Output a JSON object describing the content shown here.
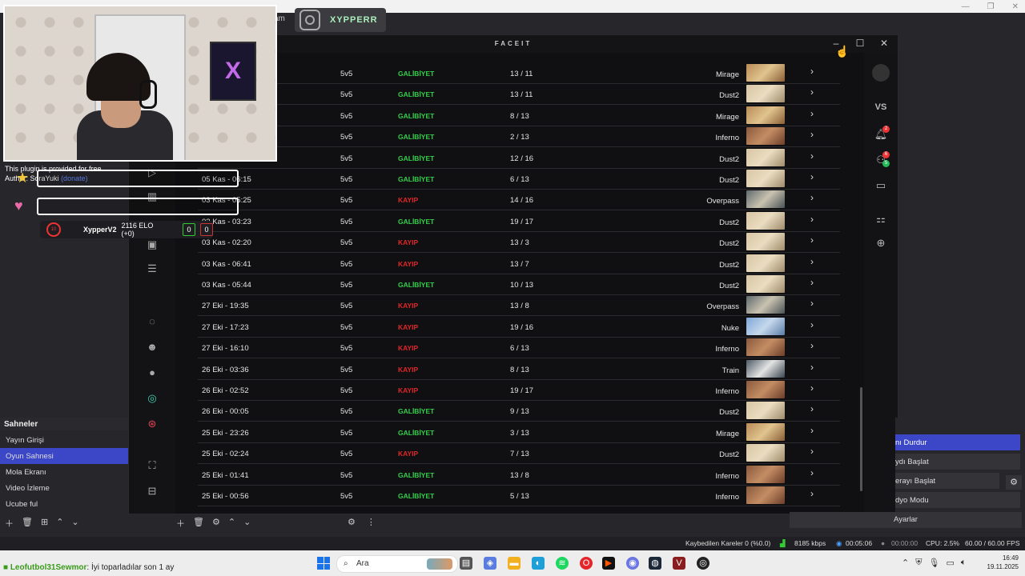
{
  "overlay": {
    "plugin_line1": "This plugin is provided for free.",
    "plugin_author": "Author: SoraYuki",
    "plugin_donate": "(donate)",
    "elo": {
      "level": "10",
      "player": "XypperV2",
      "elo": "2116 ELO (+0)",
      "wins": "0",
      "losses": "0"
    },
    "instagram": "XYPPERR",
    "fragment": "am"
  },
  "faceit": {
    "title": "FACEIT",
    "rows": [
      {
        "date": "",
        "mode": "5v5",
        "result": "GALİBİYET",
        "win": true,
        "score": "13 / 11",
        "map": "Mirage"
      },
      {
        "date": "",
        "mode": "5v5",
        "result": "GALİBİYET",
        "win": true,
        "score": "13 / 11",
        "map": "Dust2"
      },
      {
        "date": "",
        "mode": "5v5",
        "result": "GALİBİYET",
        "win": true,
        "score": "8 / 13",
        "map": "Mirage"
      },
      {
        "date": "",
        "mode": "5v5",
        "result": "GALİBİYET",
        "win": true,
        "score": "2 / 13",
        "map": "Inferno"
      },
      {
        "date": "",
        "mode": "5v5",
        "result": "GALİBİYET",
        "win": true,
        "score": "12 / 16",
        "map": "Dust2"
      },
      {
        "date": "05 Kas - 06:15",
        "mode": "5v5",
        "result": "GALİBİYET",
        "win": true,
        "score": "6 / 13",
        "map": "Dust2"
      },
      {
        "date": "03 Kas - 05:25",
        "mode": "5v5",
        "result": "KAYIP",
        "win": false,
        "score": "14 / 16",
        "map": "Overpass"
      },
      {
        "date": "03 Kas - 03:23",
        "mode": "5v5",
        "result": "GALİBİYET",
        "win": true,
        "score": "19 / 17",
        "map": "Dust2"
      },
      {
        "date": "03 Kas - 02:20",
        "mode": "5v5",
        "result": "KAYIP",
        "win": false,
        "score": "13 / 3",
        "map": "Dust2"
      },
      {
        "date": "03 Kas - 06:41",
        "mode": "5v5",
        "result": "KAYIP",
        "win": false,
        "score": "13 / 7",
        "map": "Dust2"
      },
      {
        "date": "03 Kas - 05:44",
        "mode": "5v5",
        "result": "GALİBİYET",
        "win": true,
        "score": "10 / 13",
        "map": "Dust2"
      },
      {
        "date": "27 Eki - 19:35",
        "mode": "5v5",
        "result": "KAYIP",
        "win": false,
        "score": "13 / 8",
        "map": "Overpass"
      },
      {
        "date": "27 Eki - 17:23",
        "mode": "5v5",
        "result": "KAYIP",
        "win": false,
        "score": "19 / 16",
        "map": "Nuke"
      },
      {
        "date": "27 Eki - 16:10",
        "mode": "5v5",
        "result": "KAYIP",
        "win": false,
        "score": "6 / 13",
        "map": "Inferno"
      },
      {
        "date": "26 Eki - 03:36",
        "mode": "5v5",
        "result": "KAYIP",
        "win": false,
        "score": "8 / 13",
        "map": "Train"
      },
      {
        "date": "26 Eki - 02:52",
        "mode": "5v5",
        "result": "KAYIP",
        "win": false,
        "score": "19 / 17",
        "map": "Inferno"
      },
      {
        "date": "26 Eki - 00:05",
        "mode": "5v5",
        "result": "GALİBİYET",
        "win": true,
        "score": "9 / 13",
        "map": "Dust2"
      },
      {
        "date": "25 Eki - 23:26",
        "mode": "5v5",
        "result": "GALİBİYET",
        "win": true,
        "score": "3 / 13",
        "map": "Mirage"
      },
      {
        "date": "25 Eki - 02:24",
        "mode": "5v5",
        "result": "KAYIP",
        "win": false,
        "score": "7 / 13",
        "map": "Dust2"
      },
      {
        "date": "25 Eki - 01:41",
        "mode": "5v5",
        "result": "GALİBİYET",
        "win": true,
        "score": "13 / 8",
        "map": "Inferno"
      },
      {
        "date": "25 Eki - 00:56",
        "mode": "5v5",
        "result": "GALİBİYET",
        "win": true,
        "score": "5 / 13",
        "map": "Inferno"
      }
    ],
    "right_rail": {
      "vs": "VS",
      "notif_count": "2",
      "friends_count": "6",
      "online_count": "5"
    }
  },
  "obs": {
    "scenes_title": "Sahneler",
    "scenes": [
      "Yayın Girişi",
      "Oyun Sahnesi",
      "Mola Ekranı",
      "Video İzleme",
      "Ucube ful"
    ],
    "selected_scene": 1,
    "controls": [
      "nı Durdur",
      "ydı Başlat",
      "erayı Başlat",
      "dyo Modu"
    ],
    "settings": "Ayarlar",
    "status": {
      "dropped": "Kaybedilen Kareler 0 (%0.0)",
      "bitrate": "8185 kbps",
      "live_time": "00:05:06",
      "rec_time": "00:00:00",
      "cpu": "CPU: 2.5%",
      "fps": "60.00 / 60.00 FPS"
    }
  },
  "taskbar": {
    "ticker_user": "Leofutbol31Sewmor",
    "ticker_msg": ": İyi toparladılar son 1 ay",
    "search": "Ara",
    "time": "16:49",
    "date": "19.11.2025"
  }
}
